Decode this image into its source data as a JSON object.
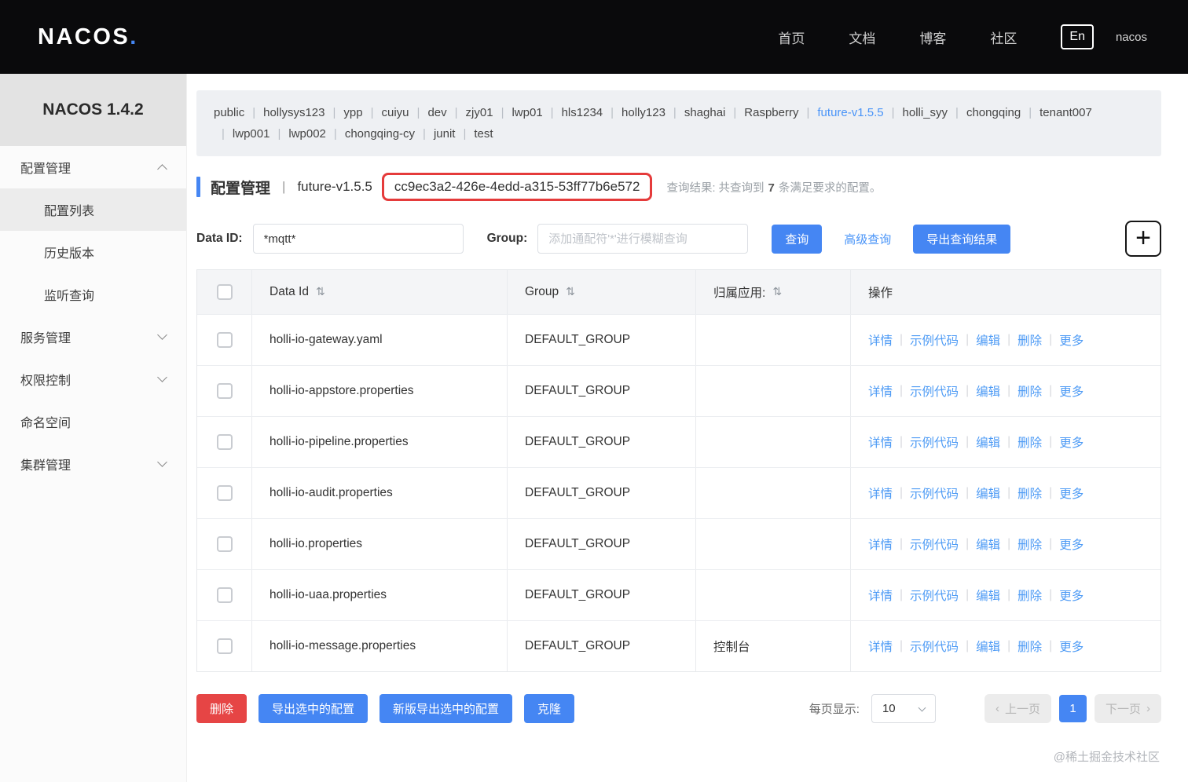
{
  "colors": {
    "header_bg": "#0a0a0c",
    "accent_blue": "#4586f3",
    "link_blue": "#4e9bf5",
    "danger_red": "#e64545",
    "highlight_box_red": "#e53b3b",
    "namespace_panel_bg": "#eef0f3",
    "table_header_bg": "#f4f5f7"
  },
  "icons": {
    "sort": "⇅",
    "plus": "+",
    "prev_arrow": "‹",
    "next_arrow": "›"
  },
  "topnav": {
    "brand_main": "NACOS",
    "brand_dot": ".",
    "items": [
      {
        "key": "home",
        "label": "首页"
      },
      {
        "key": "docs",
        "label": "文档"
      },
      {
        "key": "blog",
        "label": "博客"
      },
      {
        "key": "community",
        "label": "社区"
      }
    ],
    "lang": "En",
    "user": "nacos"
  },
  "sidebar": {
    "title": "NACOS 1.4.2",
    "groups": [
      {
        "key": "config-management",
        "label": "配置管理",
        "chevron": "up",
        "children": [
          {
            "key": "config-list",
            "label": "配置列表",
            "active": true
          },
          {
            "key": "history-versions",
            "label": "历史版本",
            "active": false
          },
          {
            "key": "listening-query",
            "label": "监听查询",
            "active": false
          }
        ]
      },
      {
        "key": "service-management",
        "label": "服务管理",
        "chevron": "down"
      },
      {
        "key": "permission-control",
        "label": "权限控制",
        "chevron": "down"
      },
      {
        "key": "namespace",
        "label": "命名空间",
        "chevron": "none"
      },
      {
        "key": "cluster-management",
        "label": "集群管理",
        "chevron": "down"
      }
    ]
  },
  "namespaces": {
    "active": "future-v1.5.5",
    "separator": "|",
    "items": [
      "public",
      "hollysys123",
      "ypp",
      "cuiyu",
      "dev",
      "zjy01",
      "lwp01",
      "hls1234",
      "holly123",
      "shaghai",
      "Raspberry",
      "future-v1.5.5",
      "holli_syy",
      "chongqing",
      "tenant007",
      "lwp001",
      "lwp002",
      "chongqing-cy",
      "junit",
      "test"
    ]
  },
  "breadcrumb": {
    "section": "配置管理",
    "separator": "|",
    "namespace": "future-v1.5.5",
    "namespace_id": "cc9ec3a2-426e-4edd-a315-53ff77b6e572",
    "result_prefix": "查询结果: 共查询到",
    "result_count": "7",
    "result_suffix": "条满足要求的配置。"
  },
  "search": {
    "data_id_label": "Data ID:",
    "data_id_value": "*mqtt*",
    "group_label": "Group:",
    "group_placeholder": "添加通配符'*'进行模糊查询",
    "query_button": "查询",
    "advanced_link": "高级查询",
    "export_button": "导出查询结果"
  },
  "table": {
    "headers": {
      "data_id": "Data Id",
      "group": "Group",
      "app": "归属应用:",
      "ops": "操作"
    },
    "action_separator": "|",
    "actions": [
      {
        "key": "detail",
        "label": "详情"
      },
      {
        "key": "sample-code",
        "label": "示例代码"
      },
      {
        "key": "edit",
        "label": "编辑"
      },
      {
        "key": "delete",
        "label": "删除"
      },
      {
        "key": "more",
        "label": "更多"
      }
    ],
    "rows": [
      {
        "data_id": "holli-io-gateway.yaml",
        "group": "DEFAULT_GROUP",
        "app": ""
      },
      {
        "data_id": "holli-io-appstore.properties",
        "group": "DEFAULT_GROUP",
        "app": ""
      },
      {
        "data_id": "holli-io-pipeline.properties",
        "group": "DEFAULT_GROUP",
        "app": ""
      },
      {
        "data_id": "holli-io-audit.properties",
        "group": "DEFAULT_GROUP",
        "app": ""
      },
      {
        "data_id": "holli-io.properties",
        "group": "DEFAULT_GROUP",
        "app": ""
      },
      {
        "data_id": "holli-io-uaa.properties",
        "group": "DEFAULT_GROUP",
        "app": ""
      },
      {
        "data_id": "holli-io-message.properties",
        "group": "DEFAULT_GROUP",
        "app": "控制台"
      }
    ]
  },
  "footer": {
    "delete_button": "删除",
    "export_selected_button": "导出选中的配置",
    "export_selected_new_button": "新版导出选中的配置",
    "clone_button": "克隆",
    "page_size_label": "每页显示:",
    "page_size_value": "10",
    "prev_button": "上一页",
    "current_page": "1",
    "next_button": "下一页",
    "watermark": "@稀土掘金技术社区"
  }
}
